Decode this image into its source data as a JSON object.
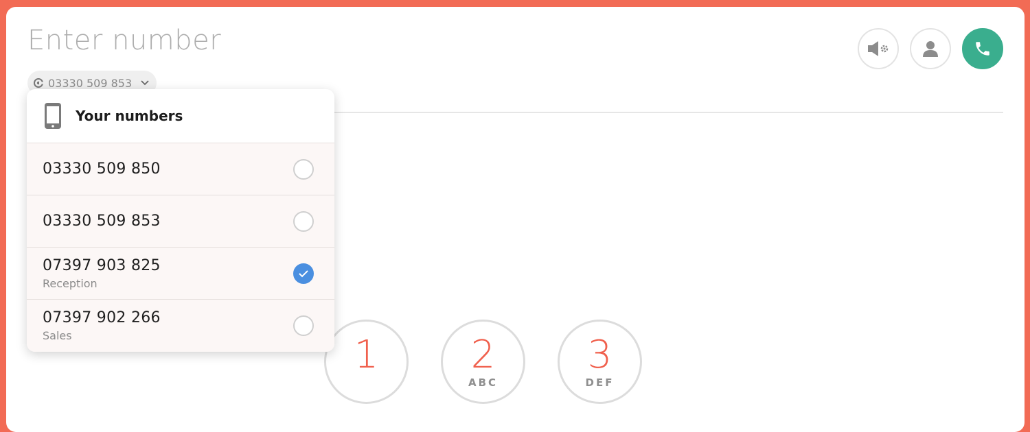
{
  "dialer": {
    "placeholder": "Enter number",
    "value": ""
  },
  "caller_id": {
    "selected": "03330 509 853",
    "icons": {
      "source": "caller-id-icon",
      "chevron": "chevron-down-icon"
    }
  },
  "actions": [
    {
      "name": "audio-settings",
      "icon": "speaker-settings-icon"
    },
    {
      "name": "contacts",
      "icon": "user-icon"
    },
    {
      "name": "call",
      "icon": "phone-icon",
      "color": "#3aae8e"
    }
  ],
  "numbers_dropdown": {
    "title": "Your numbers",
    "icon": "mobile-phone-icon",
    "items": [
      {
        "number": "03330 509 850",
        "label": "",
        "checked": false
      },
      {
        "number": "03330 509 853",
        "label": "",
        "checked": false
      },
      {
        "number": "07397 903 825",
        "label": "Reception",
        "checked": true
      },
      {
        "number": "07397 902 266",
        "label": "Sales",
        "checked": false
      }
    ]
  },
  "keypad": [
    {
      "digit": "1",
      "letters": ""
    },
    {
      "digit": "2",
      "letters": "ABC"
    },
    {
      "digit": "3",
      "letters": "DEF"
    }
  ],
  "colors": {
    "background": "#f26b55",
    "accent_digit": "#f0604d",
    "call_green": "#3aae8e",
    "checked_blue": "#4a8fe0"
  }
}
